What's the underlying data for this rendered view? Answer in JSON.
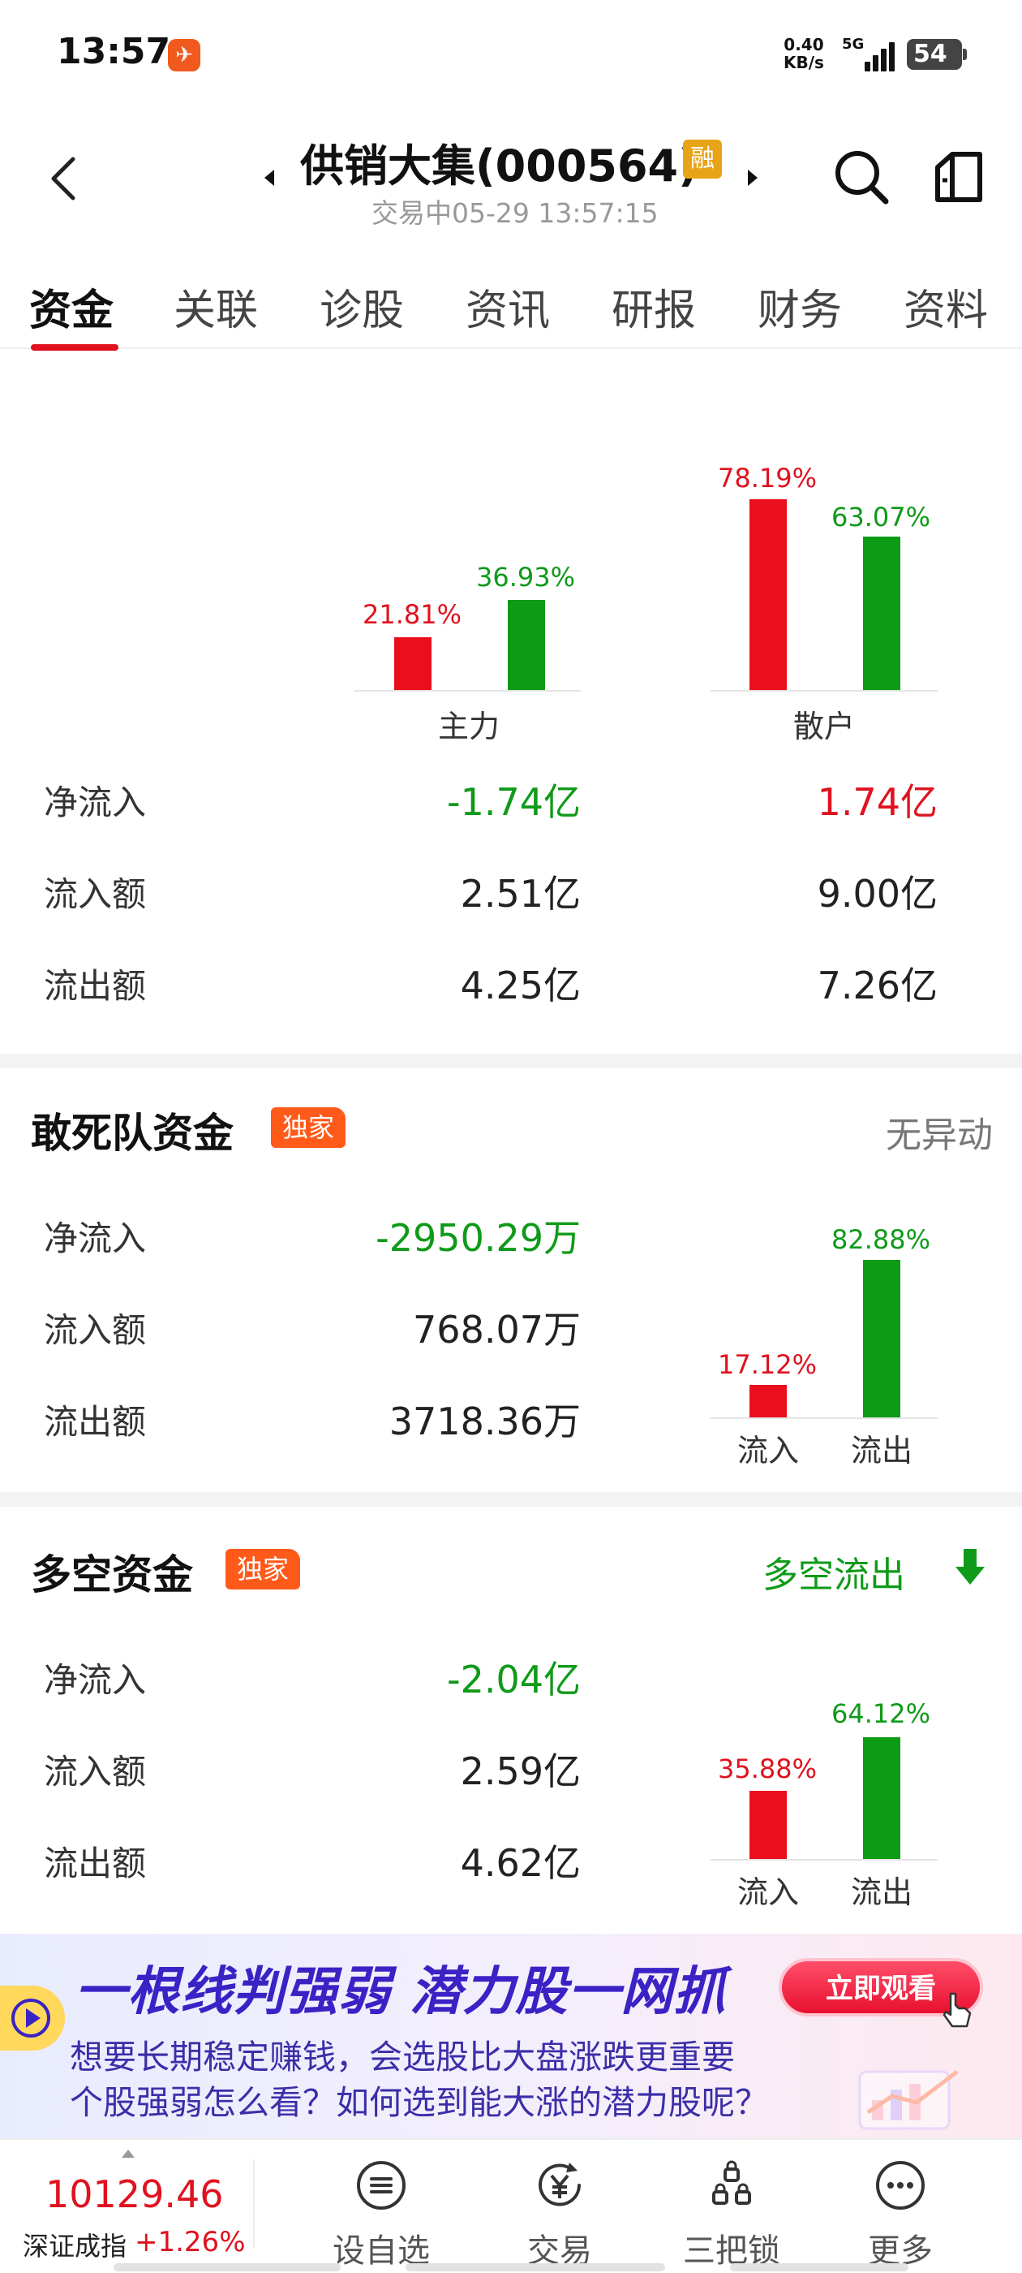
{
  "status_bar": {
    "time": "13:57",
    "net_speed_value": "0.40",
    "net_speed_unit": "KB/s",
    "network": "5G",
    "battery": "54"
  },
  "header": {
    "title": "供销大集(000564)",
    "margin_badge": "融",
    "trade_status": "交易中05-29 13:57:15"
  },
  "tabs": [
    {
      "label": "资金",
      "active": true
    },
    {
      "label": "关联"
    },
    {
      "label": "诊股"
    },
    {
      "label": "资讯"
    },
    {
      "label": "研报"
    },
    {
      "label": "财务"
    },
    {
      "label": "资料"
    }
  ],
  "main_retail": {
    "groups": [
      {
        "label": "主力",
        "inflow_pct": "21.81%",
        "outflow_pct": "36.93%",
        "inflow": 21.81,
        "outflow": 36.93
      },
      {
        "label": "散户",
        "inflow_pct": "78.19%",
        "outflow_pct": "63.07%",
        "inflow": 78.19,
        "outflow": 63.07
      }
    ],
    "rows": [
      {
        "label": "净流入",
        "main": "-1.74亿",
        "retail": "1.74亿"
      },
      {
        "label": "流入额",
        "main": "2.51亿",
        "retail": "9.00亿"
      },
      {
        "label": "流出额",
        "main": "4.25亿",
        "retail": "7.26亿"
      }
    ]
  },
  "dare_to_die": {
    "title": "敢死队资金",
    "badge": "独家",
    "status": "无异动",
    "rows": [
      {
        "label": "净流入",
        "value": "-2950.29万"
      },
      {
        "label": "流入额",
        "value": "768.07万"
      },
      {
        "label": "流出额",
        "value": "3718.36万"
      }
    ],
    "chart": {
      "inflow_pct": "17.12%",
      "outflow_pct": "82.88%",
      "inflow": 17.12,
      "outflow": 82.88,
      "inflow_label": "流入",
      "outflow_label": "流出"
    }
  },
  "long_short": {
    "title": "多空资金",
    "badge": "独家",
    "status": "多空流出",
    "rows": [
      {
        "label": "净流入",
        "value": "-2.04亿"
      },
      {
        "label": "流入额",
        "value": "2.59亿"
      },
      {
        "label": "流出额",
        "value": "4.62亿"
      }
    ],
    "chart": {
      "inflow_pct": "35.88%",
      "outflow_pct": "64.12%",
      "inflow": 35.88,
      "outflow": 64.12,
      "inflow_label": "流入",
      "outflow_label": "流出"
    }
  },
  "banner": {
    "headline": "一根线判强弱 潜力股一网抓",
    "cta": "立即观看",
    "line1": "想要长期稳定赚钱，会选股比大盘涨跌更重要",
    "line2": "个股强弱怎么看？如何选到能大涨的潜力股呢？"
  },
  "bottom_bar": {
    "index_value": "10129.46",
    "index_name": "深证成指",
    "index_change": "+1.26%",
    "nav": [
      {
        "label": "设自选",
        "icon": "list-circle-icon"
      },
      {
        "label": "交易",
        "icon": "yuan-circle-icon"
      },
      {
        "label": "三把锁",
        "icon": "lock-group-icon"
      },
      {
        "label": "更多",
        "icon": "more-dots-icon"
      }
    ]
  },
  "colors": {
    "up": "#e0121f",
    "down": "#0f9a19",
    "accent": "#ff5a1a"
  }
}
